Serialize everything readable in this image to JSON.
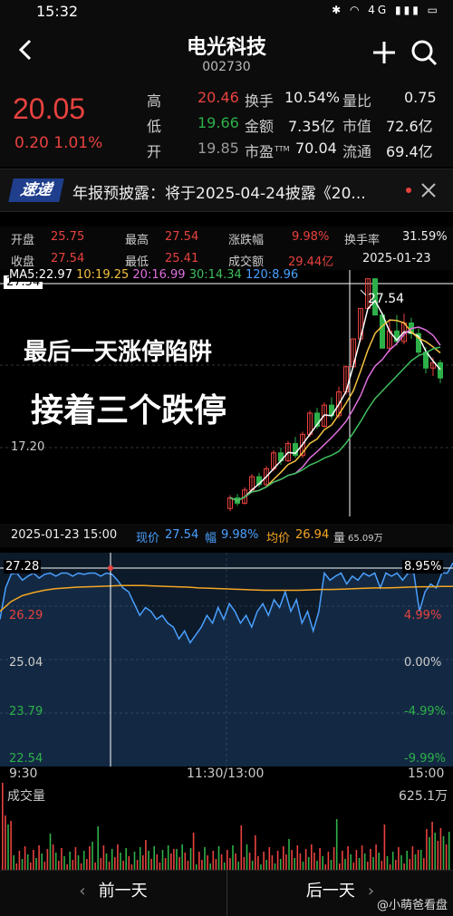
{
  "status_bar": {
    "time": "15:32",
    "icons": [
      "bluetooth-icon",
      "wifi-icon",
      "signal-icon",
      "battery-icon"
    ],
    "icons_text": "✱ ◠ 4G ▮▮▮ ▭"
  },
  "header": {
    "stock_name": "电光科技",
    "stock_code": "002730"
  },
  "quote": {
    "price": "20.05",
    "change": "0.20 1.01%",
    "rows": [
      {
        "label1": "高",
        "value1": "20.46",
        "label2": "换手",
        "value2": "10.54%",
        "label3": "量比",
        "value3": "0.75"
      },
      {
        "label1": "低",
        "value1": "19.66",
        "label2": "金额",
        "value2": "7.35亿",
        "label3": "市值",
        "value3": "72.6亿"
      },
      {
        "label1": "开",
        "value1": "19.85",
        "label2": "市盈",
        "label2_sub": "TTM",
        "value2": "70.04",
        "label3": "流通",
        "value3": "69.4亿"
      }
    ]
  },
  "ticker": {
    "logo": "速递",
    "text": "年报预披露：将于2025-04-24披露《20..."
  },
  "day_stats": {
    "row1": [
      {
        "label": "开盘",
        "value": "25.75"
      },
      {
        "label": "最高",
        "value": "27.54"
      },
      {
        "label": "涨跌幅",
        "value": "9.98%"
      },
      {
        "label": "换手率",
        "value": "31.59%"
      }
    ],
    "row2": [
      {
        "label": "收盘",
        "value": "27.54"
      },
      {
        "label": "最低",
        "value": "25.41"
      },
      {
        "label": "成交额",
        "value": "29.44亿"
      },
      {
        "label": "",
        "value": "2025-01-23"
      }
    ]
  },
  "kline": {
    "ma_labels": [
      {
        "text": "MA5:22.97",
        "color": "#ffffff"
      },
      {
        "text": "10:19.25",
        "color": "#f5c242"
      },
      {
        "text": "20:16.99",
        "color": "#e070e0"
      },
      {
        "text": "30:14.34",
        "color": "#3fbf5f"
      },
      {
        "text": "120:8.96",
        "color": "#4aa0ff"
      }
    ],
    "y_top": "27.54",
    "y_mid": "17.20",
    "high_label": "27.54",
    "annotation_line1": "最后一天涨停陷阱",
    "annotation_line2": "接着三个跌停",
    "colors": {
      "up": "#e8423f",
      "down": "#2eb049"
    }
  },
  "intraday_header": {
    "datetime": "2025-01-23 15:00",
    "price_label": "现价",
    "price_value": "27.54",
    "pct_label": "幅",
    "pct_value": "9.98%",
    "avg_label": "均价",
    "avg_value": "26.94",
    "vol_label": "量",
    "vol_value": "65.09万"
  },
  "intraday": {
    "left_labels": [
      "27.28",
      "26.29",
      "25.04",
      "23.79",
      "22.54"
    ],
    "right_labels": [
      "8.95%",
      "4.99%",
      "0.00%",
      "-4.99%",
      "-9.99%"
    ],
    "time_labels": [
      "9:30",
      "11:30/13:00",
      "15:00"
    ],
    "price_series": [
      26.1,
      26.9,
      27.25,
      27.28,
      27.1,
      27.2,
      27.28,
      27.15,
      27.25,
      27.28,
      27.2,
      27.28,
      27.28,
      27.2,
      27.28,
      27.25,
      27.28,
      27.28,
      27.2,
      27.28,
      27.25,
      27.1,
      26.9,
      26.8,
      26.5,
      26.2,
      26.4,
      26.3,
      26.1,
      26.2,
      26.0,
      25.9,
      25.6,
      25.8,
      25.5,
      25.7,
      25.9,
      26.2,
      26.0,
      26.4,
      26.1,
      26.5,
      26.3,
      26.0,
      26.2,
      25.9,
      26.3,
      26.5,
      26.2,
      26.6,
      26.4,
      26.8,
      26.3,
      26.6,
      26.0,
      26.3,
      25.8,
      26.3,
      27.28,
      27.1,
      27.2,
      27.28,
      27.0,
      27.2,
      27.1,
      27.28,
      27.2,
      27.28,
      26.9,
      27.28,
      27.2,
      27.28,
      27.1,
      27.28,
      27.28,
      26.3,
      26.8,
      27.0,
      26.9,
      27.28,
      27.28,
      27.54
    ],
    "avg_series": [
      26.3,
      26.55,
      26.7,
      26.78,
      26.84,
      26.88,
      26.9,
      26.92,
      26.93,
      26.94,
      26.95,
      26.96,
      26.96,
      26.96,
      26.95,
      26.94,
      26.93,
      26.92,
      26.9,
      26.89,
      26.88,
      26.87,
      26.86,
      26.85,
      26.84,
      26.84,
      26.84,
      26.84,
      26.85,
      26.86,
      26.86,
      26.87,
      26.88,
      26.89,
      26.9,
      26.9,
      26.91,
      26.92,
      26.93,
      26.93,
      26.94,
      26.94
    ],
    "prev_close": 25.04,
    "colors": {
      "price": "#4aa0ff",
      "avg": "#f5a623"
    }
  },
  "volume": {
    "label": "成交量",
    "max": "625.1万"
  },
  "bottom_nav": {
    "prev": "前一天",
    "next": "后一天",
    "watermark": "@小萌爸看盘"
  }
}
